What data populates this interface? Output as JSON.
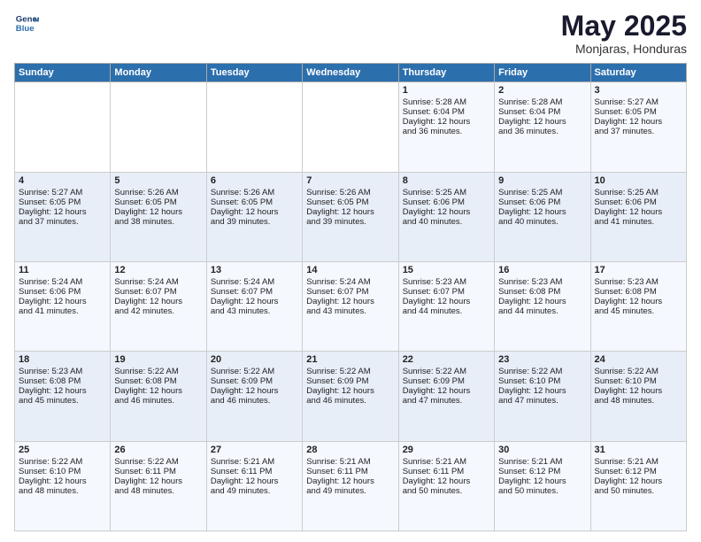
{
  "logo": {
    "line1": "General",
    "line2": "Blue"
  },
  "title": "May 2025",
  "location": "Monjaras, Honduras",
  "days_of_week": [
    "Sunday",
    "Monday",
    "Tuesday",
    "Wednesday",
    "Thursday",
    "Friday",
    "Saturday"
  ],
  "weeks": [
    [
      {
        "day": "",
        "info": ""
      },
      {
        "day": "",
        "info": ""
      },
      {
        "day": "",
        "info": ""
      },
      {
        "day": "",
        "info": ""
      },
      {
        "day": "1",
        "info": "Sunrise: 5:28 AM\nSunset: 6:04 PM\nDaylight: 12 hours\nand 36 minutes."
      },
      {
        "day": "2",
        "info": "Sunrise: 5:28 AM\nSunset: 6:04 PM\nDaylight: 12 hours\nand 36 minutes."
      },
      {
        "day": "3",
        "info": "Sunrise: 5:27 AM\nSunset: 6:05 PM\nDaylight: 12 hours\nand 37 minutes."
      }
    ],
    [
      {
        "day": "4",
        "info": "Sunrise: 5:27 AM\nSunset: 6:05 PM\nDaylight: 12 hours\nand 37 minutes."
      },
      {
        "day": "5",
        "info": "Sunrise: 5:26 AM\nSunset: 6:05 PM\nDaylight: 12 hours\nand 38 minutes."
      },
      {
        "day": "6",
        "info": "Sunrise: 5:26 AM\nSunset: 6:05 PM\nDaylight: 12 hours\nand 39 minutes."
      },
      {
        "day": "7",
        "info": "Sunrise: 5:26 AM\nSunset: 6:05 PM\nDaylight: 12 hours\nand 39 minutes."
      },
      {
        "day": "8",
        "info": "Sunrise: 5:25 AM\nSunset: 6:06 PM\nDaylight: 12 hours\nand 40 minutes."
      },
      {
        "day": "9",
        "info": "Sunrise: 5:25 AM\nSunset: 6:06 PM\nDaylight: 12 hours\nand 40 minutes."
      },
      {
        "day": "10",
        "info": "Sunrise: 5:25 AM\nSunset: 6:06 PM\nDaylight: 12 hours\nand 41 minutes."
      }
    ],
    [
      {
        "day": "11",
        "info": "Sunrise: 5:24 AM\nSunset: 6:06 PM\nDaylight: 12 hours\nand 41 minutes."
      },
      {
        "day": "12",
        "info": "Sunrise: 5:24 AM\nSunset: 6:07 PM\nDaylight: 12 hours\nand 42 minutes."
      },
      {
        "day": "13",
        "info": "Sunrise: 5:24 AM\nSunset: 6:07 PM\nDaylight: 12 hours\nand 43 minutes."
      },
      {
        "day": "14",
        "info": "Sunrise: 5:24 AM\nSunset: 6:07 PM\nDaylight: 12 hours\nand 43 minutes."
      },
      {
        "day": "15",
        "info": "Sunrise: 5:23 AM\nSunset: 6:07 PM\nDaylight: 12 hours\nand 44 minutes."
      },
      {
        "day": "16",
        "info": "Sunrise: 5:23 AM\nSunset: 6:08 PM\nDaylight: 12 hours\nand 44 minutes."
      },
      {
        "day": "17",
        "info": "Sunrise: 5:23 AM\nSunset: 6:08 PM\nDaylight: 12 hours\nand 45 minutes."
      }
    ],
    [
      {
        "day": "18",
        "info": "Sunrise: 5:23 AM\nSunset: 6:08 PM\nDaylight: 12 hours\nand 45 minutes."
      },
      {
        "day": "19",
        "info": "Sunrise: 5:22 AM\nSunset: 6:08 PM\nDaylight: 12 hours\nand 46 minutes."
      },
      {
        "day": "20",
        "info": "Sunrise: 5:22 AM\nSunset: 6:09 PM\nDaylight: 12 hours\nand 46 minutes."
      },
      {
        "day": "21",
        "info": "Sunrise: 5:22 AM\nSunset: 6:09 PM\nDaylight: 12 hours\nand 46 minutes."
      },
      {
        "day": "22",
        "info": "Sunrise: 5:22 AM\nSunset: 6:09 PM\nDaylight: 12 hours\nand 47 minutes."
      },
      {
        "day": "23",
        "info": "Sunrise: 5:22 AM\nSunset: 6:10 PM\nDaylight: 12 hours\nand 47 minutes."
      },
      {
        "day": "24",
        "info": "Sunrise: 5:22 AM\nSunset: 6:10 PM\nDaylight: 12 hours\nand 48 minutes."
      }
    ],
    [
      {
        "day": "25",
        "info": "Sunrise: 5:22 AM\nSunset: 6:10 PM\nDaylight: 12 hours\nand 48 minutes."
      },
      {
        "day": "26",
        "info": "Sunrise: 5:22 AM\nSunset: 6:11 PM\nDaylight: 12 hours\nand 48 minutes."
      },
      {
        "day": "27",
        "info": "Sunrise: 5:21 AM\nSunset: 6:11 PM\nDaylight: 12 hours\nand 49 minutes."
      },
      {
        "day": "28",
        "info": "Sunrise: 5:21 AM\nSunset: 6:11 PM\nDaylight: 12 hours\nand 49 minutes."
      },
      {
        "day": "29",
        "info": "Sunrise: 5:21 AM\nSunset: 6:11 PM\nDaylight: 12 hours\nand 50 minutes."
      },
      {
        "day": "30",
        "info": "Sunrise: 5:21 AM\nSunset: 6:12 PM\nDaylight: 12 hours\nand 50 minutes."
      },
      {
        "day": "31",
        "info": "Sunrise: 5:21 AM\nSunset: 6:12 PM\nDaylight: 12 hours\nand 50 minutes."
      }
    ]
  ]
}
